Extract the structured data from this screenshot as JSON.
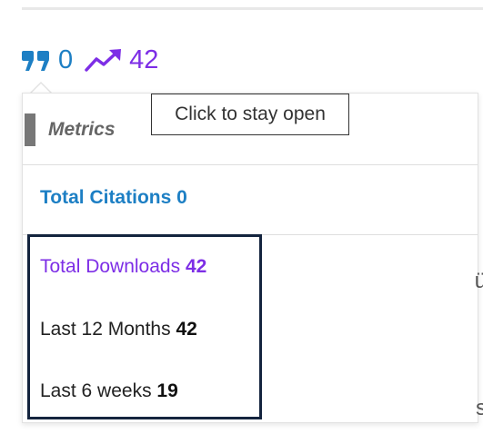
{
  "stats": {
    "citations": "0",
    "downloads": "42"
  },
  "tooltip": {
    "text": "Click to stay open"
  },
  "metrics": {
    "title": "Metrics",
    "total_citations_label": "Total Citations",
    "total_citations_value": "0",
    "total_downloads_label": "Total Downloads",
    "total_downloads_value": "42",
    "last_12_months_label": "Last 12 Months",
    "last_12_months_value": "42",
    "last_6_weeks_label": "Last 6 weeks",
    "last_6_weeks_value": "19"
  },
  "icons": {
    "citations": "quote-icon",
    "downloads": "trending-up-icon"
  },
  "colors": {
    "citations": "#1d7fc4",
    "downloads": "#7d2ee6",
    "highlight": "#14243e"
  }
}
